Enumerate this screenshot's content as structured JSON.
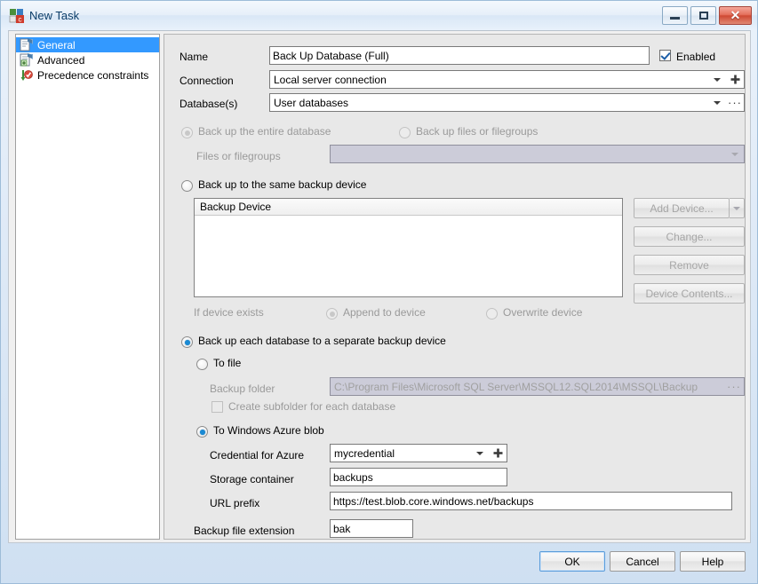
{
  "window": {
    "title": "New Task",
    "icon": "task-icon",
    "buttons": {
      "minimize": "minimize-button",
      "maximize": "maximize-button",
      "close": "close-button",
      "close_glyph": "✕"
    }
  },
  "sidebar": {
    "items": [
      {
        "label": "General",
        "icon": "page-general-icon",
        "selected": true
      },
      {
        "label": "Advanced",
        "icon": "page-advanced-icon",
        "selected": false
      },
      {
        "label": "Precedence constraints",
        "icon": "precedence-constraints-icon",
        "selected": false
      }
    ]
  },
  "form": {
    "name_label": "Name",
    "name_value": "Back Up Database (Full)",
    "enabled_label": "Enabled",
    "enabled_checked": true,
    "connection_label": "Connection",
    "connection_value": "Local server connection",
    "connection_add_glyph": "＋",
    "databases_label": "Database(s)",
    "databases_value": "User databases",
    "databases_more_glyph": "···"
  },
  "scope": {
    "entire_database_label": "Back up the entire database",
    "entire_database_selected": true,
    "entire_database_disabled": true,
    "files_filegroups_label": "Back up files or filegroups",
    "files_filegroups_selected": false,
    "files_filegroups_disabled": true,
    "files_field_label": "Files or filegroups",
    "files_field_value": "",
    "files_field_disabled": true
  },
  "same_device": {
    "radio_label": "Back up to the same backup device",
    "selected": false,
    "list_header": "Backup Device",
    "list_rows": [],
    "buttons": [
      {
        "label": "Add Device...",
        "name": "add-device-button",
        "split": true,
        "disabled": true
      },
      {
        "label": "Change...",
        "name": "change-button",
        "split": false,
        "disabled": true
      },
      {
        "label": "Remove",
        "name": "remove-button",
        "split": false,
        "disabled": true
      },
      {
        "label": "Device Contents...",
        "name": "device-contents-button",
        "split": false,
        "disabled": true
      }
    ],
    "if_exists_label": "If device exists",
    "append_label": "Append to device",
    "append_selected": true,
    "overwrite_label": "Overwrite device",
    "overwrite_selected": false,
    "if_exists_disabled": true
  },
  "separate_device": {
    "radio_label": "Back up each database to a separate backup device",
    "selected": true,
    "to_file_label": "To file",
    "to_file_selected": false,
    "backup_folder_label": "Backup folder",
    "backup_folder_value": "C:\\Program Files\\Microsoft SQL Server\\MSSQL12.SQL2014\\MSSQL\\Backup",
    "backup_folder_disabled": true,
    "backup_folder_browse_glyph": "···",
    "create_subfolder_label": "Create subfolder for each database",
    "create_subfolder_checked": false,
    "create_subfolder_disabled": true,
    "to_azure_label": "To Windows Azure blob",
    "to_azure_selected": true,
    "credential_label": "Credential for Azure",
    "credential_value": "mycredential",
    "credential_add_glyph": "＋",
    "storage_container_label": "Storage container",
    "storage_container_value": "backups",
    "url_prefix_label": "URL prefix",
    "url_prefix_value": "https://test.blob.core.windows.net/backups",
    "extension_label": "Backup file extension",
    "extension_value": "bak"
  },
  "footer": {
    "ok": "OK",
    "cancel": "Cancel",
    "help": "Help"
  },
  "colors": {
    "selection_blue": "#3399ff",
    "radio_blue": "#1a8ad4",
    "title_text": "#0b3d68",
    "disabled_text": "#9a9a9a",
    "pane_bg": "#e8e8e8"
  }
}
